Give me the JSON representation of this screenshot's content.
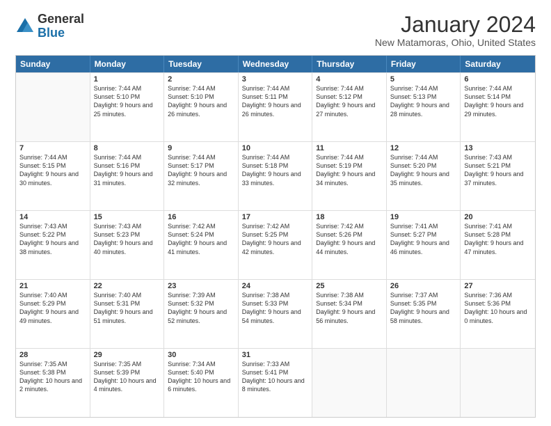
{
  "logo": {
    "general": "General",
    "blue": "Blue"
  },
  "header": {
    "title": "January 2024",
    "subtitle": "New Matamoras, Ohio, United States"
  },
  "weekdays": [
    "Sunday",
    "Monday",
    "Tuesday",
    "Wednesday",
    "Thursday",
    "Friday",
    "Saturday"
  ],
  "rows": [
    [
      {
        "day": "",
        "empty": true
      },
      {
        "day": "1",
        "sunrise": "7:44 AM",
        "sunset": "5:10 PM",
        "daylight": "9 hours and 25 minutes."
      },
      {
        "day": "2",
        "sunrise": "7:44 AM",
        "sunset": "5:10 PM",
        "daylight": "9 hours and 26 minutes."
      },
      {
        "day": "3",
        "sunrise": "7:44 AM",
        "sunset": "5:11 PM",
        "daylight": "9 hours and 26 minutes."
      },
      {
        "day": "4",
        "sunrise": "7:44 AM",
        "sunset": "5:12 PM",
        "daylight": "9 hours and 27 minutes."
      },
      {
        "day": "5",
        "sunrise": "7:44 AM",
        "sunset": "5:13 PM",
        "daylight": "9 hours and 28 minutes."
      },
      {
        "day": "6",
        "sunrise": "7:44 AM",
        "sunset": "5:14 PM",
        "daylight": "9 hours and 29 minutes."
      }
    ],
    [
      {
        "day": "7",
        "sunrise": "7:44 AM",
        "sunset": "5:15 PM",
        "daylight": "9 hours and 30 minutes."
      },
      {
        "day": "8",
        "sunrise": "7:44 AM",
        "sunset": "5:16 PM",
        "daylight": "9 hours and 31 minutes."
      },
      {
        "day": "9",
        "sunrise": "7:44 AM",
        "sunset": "5:17 PM",
        "daylight": "9 hours and 32 minutes."
      },
      {
        "day": "10",
        "sunrise": "7:44 AM",
        "sunset": "5:18 PM",
        "daylight": "9 hours and 33 minutes."
      },
      {
        "day": "11",
        "sunrise": "7:44 AM",
        "sunset": "5:19 PM",
        "daylight": "9 hours and 34 minutes."
      },
      {
        "day": "12",
        "sunrise": "7:44 AM",
        "sunset": "5:20 PM",
        "daylight": "9 hours and 35 minutes."
      },
      {
        "day": "13",
        "sunrise": "7:43 AM",
        "sunset": "5:21 PM",
        "daylight": "9 hours and 37 minutes."
      }
    ],
    [
      {
        "day": "14",
        "sunrise": "7:43 AM",
        "sunset": "5:22 PM",
        "daylight": "9 hours and 38 minutes."
      },
      {
        "day": "15",
        "sunrise": "7:43 AM",
        "sunset": "5:23 PM",
        "daylight": "9 hours and 40 minutes."
      },
      {
        "day": "16",
        "sunrise": "7:42 AM",
        "sunset": "5:24 PM",
        "daylight": "9 hours and 41 minutes."
      },
      {
        "day": "17",
        "sunrise": "7:42 AM",
        "sunset": "5:25 PM",
        "daylight": "9 hours and 42 minutes."
      },
      {
        "day": "18",
        "sunrise": "7:42 AM",
        "sunset": "5:26 PM",
        "daylight": "9 hours and 44 minutes."
      },
      {
        "day": "19",
        "sunrise": "7:41 AM",
        "sunset": "5:27 PM",
        "daylight": "9 hours and 46 minutes."
      },
      {
        "day": "20",
        "sunrise": "7:41 AM",
        "sunset": "5:28 PM",
        "daylight": "9 hours and 47 minutes."
      }
    ],
    [
      {
        "day": "21",
        "sunrise": "7:40 AM",
        "sunset": "5:29 PM",
        "daylight": "9 hours and 49 minutes."
      },
      {
        "day": "22",
        "sunrise": "7:40 AM",
        "sunset": "5:31 PM",
        "daylight": "9 hours and 51 minutes."
      },
      {
        "day": "23",
        "sunrise": "7:39 AM",
        "sunset": "5:32 PM",
        "daylight": "9 hours and 52 minutes."
      },
      {
        "day": "24",
        "sunrise": "7:38 AM",
        "sunset": "5:33 PM",
        "daylight": "9 hours and 54 minutes."
      },
      {
        "day": "25",
        "sunrise": "7:38 AM",
        "sunset": "5:34 PM",
        "daylight": "9 hours and 56 minutes."
      },
      {
        "day": "26",
        "sunrise": "7:37 AM",
        "sunset": "5:35 PM",
        "daylight": "9 hours and 58 minutes."
      },
      {
        "day": "27",
        "sunrise": "7:36 AM",
        "sunset": "5:36 PM",
        "daylight": "10 hours and 0 minutes."
      }
    ],
    [
      {
        "day": "28",
        "sunrise": "7:35 AM",
        "sunset": "5:38 PM",
        "daylight": "10 hours and 2 minutes."
      },
      {
        "day": "29",
        "sunrise": "7:35 AM",
        "sunset": "5:39 PM",
        "daylight": "10 hours and 4 minutes."
      },
      {
        "day": "30",
        "sunrise": "7:34 AM",
        "sunset": "5:40 PM",
        "daylight": "10 hours and 6 minutes."
      },
      {
        "day": "31",
        "sunrise": "7:33 AM",
        "sunset": "5:41 PM",
        "daylight": "10 hours and 8 minutes."
      },
      {
        "day": "",
        "empty": true
      },
      {
        "day": "",
        "empty": true
      },
      {
        "day": "",
        "empty": true
      }
    ]
  ]
}
